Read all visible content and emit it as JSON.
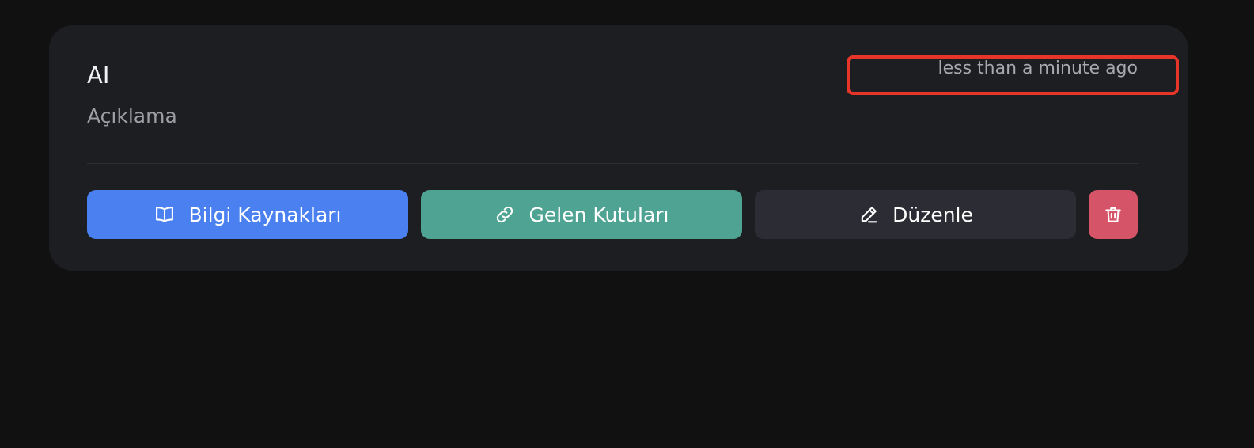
{
  "card": {
    "title": "AI",
    "description": "Açıklama",
    "timestamp": "less than a minute ago"
  },
  "actions": {
    "knowledge_sources": {
      "label": "Bilgi Kaynakları",
      "icon": "book-open-icon",
      "color": "#4a80f0"
    },
    "inboxes": {
      "label": "Gelen Kutuları",
      "icon": "link-icon",
      "color": "#4ea392"
    },
    "edit": {
      "label": "Düzenle",
      "icon": "pencil-icon",
      "color": "#2c2c35"
    },
    "delete": {
      "icon": "trash-icon",
      "color": "#d65468"
    }
  },
  "colors": {
    "page_background": "#111112",
    "card_background": "#1d1e22",
    "highlight": "#e8352a"
  }
}
